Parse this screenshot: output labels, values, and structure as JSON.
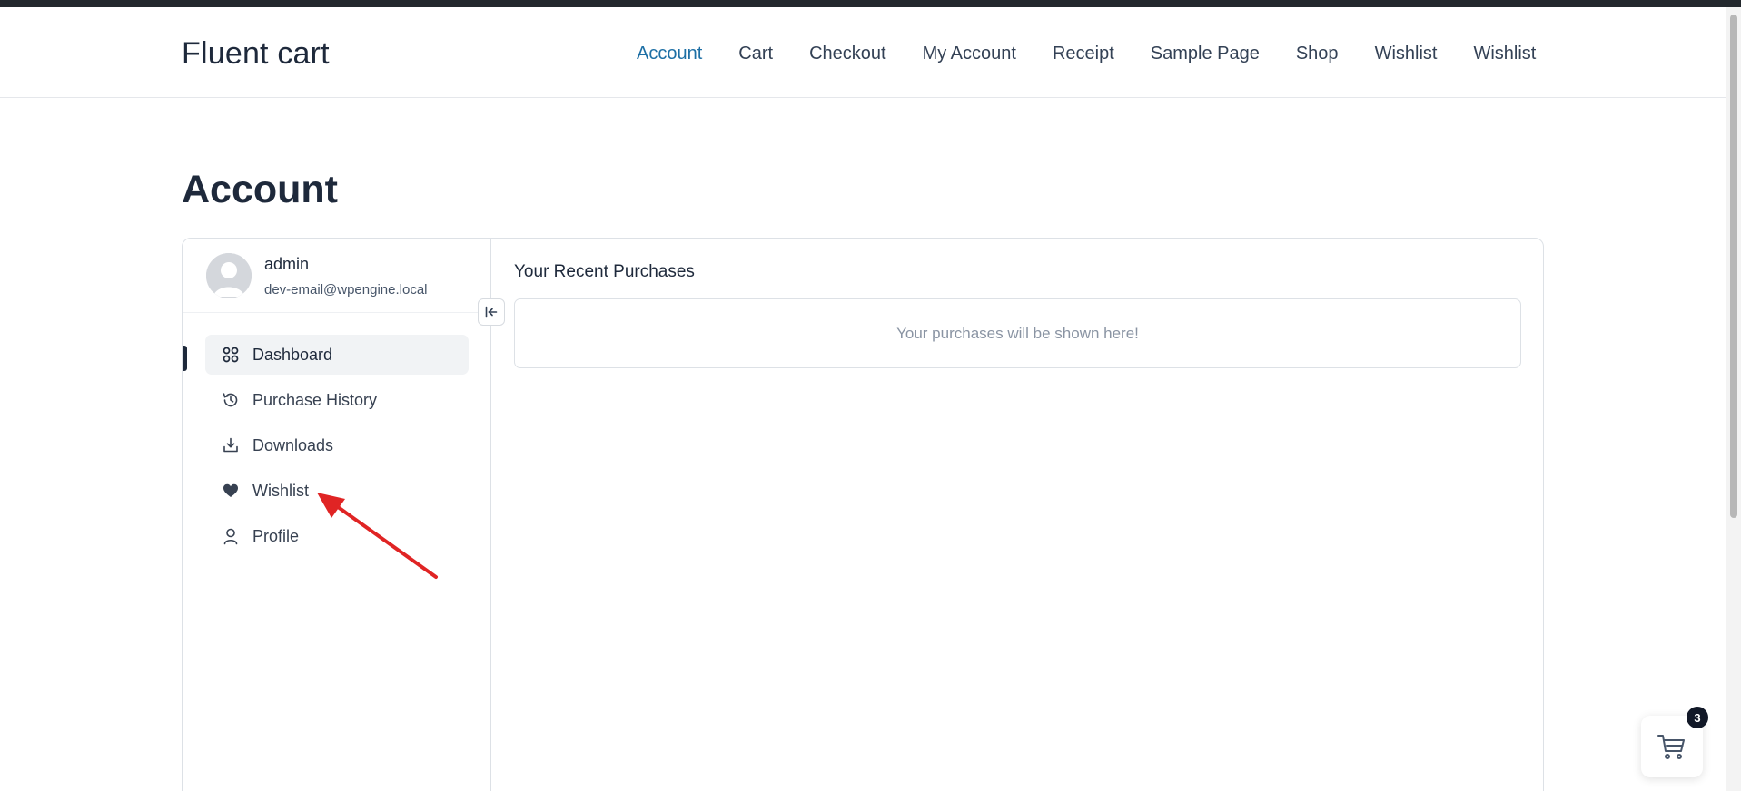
{
  "site": {
    "title": "Fluent cart",
    "nav": [
      {
        "label": "Account",
        "active": true
      },
      {
        "label": "Cart",
        "active": false
      },
      {
        "label": "Checkout",
        "active": false
      },
      {
        "label": "My Account",
        "active": false
      },
      {
        "label": "Receipt",
        "active": false
      },
      {
        "label": "Sample Page",
        "active": false
      },
      {
        "label": "Shop",
        "active": false
      },
      {
        "label": "Wishlist",
        "active": false
      },
      {
        "label": "Wishlist",
        "active": false
      }
    ]
  },
  "page": {
    "title": "Account"
  },
  "user": {
    "name": "admin",
    "email": "dev-email@wpengine.local"
  },
  "menu": [
    {
      "label": "Dashboard",
      "icon": "grid-icon",
      "active": true
    },
    {
      "label": "Purchase History",
      "icon": "history-icon",
      "active": false
    },
    {
      "label": "Downloads",
      "icon": "download-icon",
      "active": false
    },
    {
      "label": "Wishlist",
      "icon": "heart-icon",
      "active": false
    },
    {
      "label": "Profile",
      "icon": "user-icon",
      "active": false
    }
  ],
  "main": {
    "section_title": "Your Recent Purchases",
    "empty_message": "Your purchases will be shown here!"
  },
  "cart": {
    "count": "3"
  },
  "colors": {
    "accent_link": "#1d6fa5",
    "annotation_arrow": "#e02424"
  }
}
